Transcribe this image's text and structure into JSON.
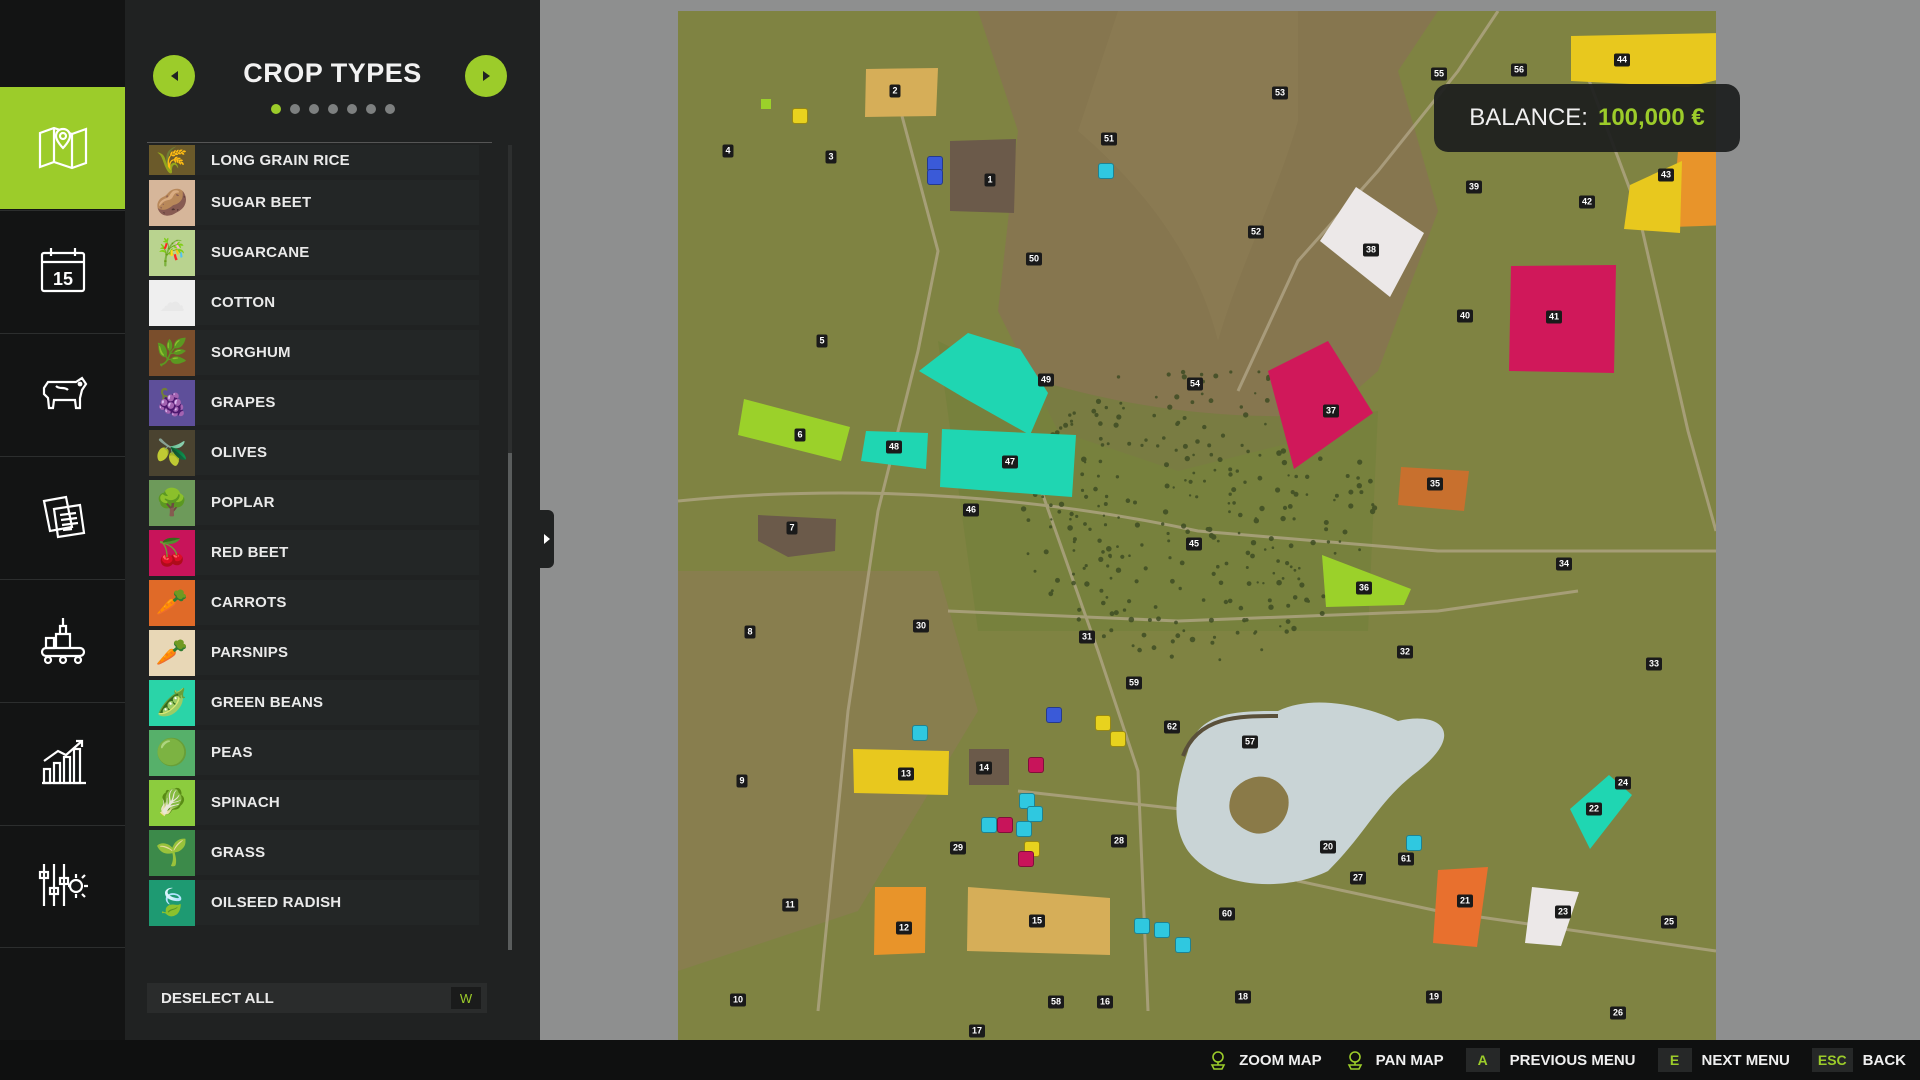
{
  "nav": {
    "items": [
      {
        "name": "map",
        "icon": "map-icon",
        "active": true
      },
      {
        "name": "calendar",
        "icon": "calendar-icon",
        "day": "15"
      },
      {
        "name": "animals",
        "icon": "cow-icon"
      },
      {
        "name": "contracts",
        "icon": "documents-icon"
      },
      {
        "name": "production",
        "icon": "factory-icon"
      },
      {
        "name": "statistics",
        "icon": "chart-icon"
      },
      {
        "name": "settings",
        "icon": "settings-icon"
      }
    ]
  },
  "panel": {
    "title": "CROP TYPES",
    "pages": 7,
    "active_page": 1,
    "crops": [
      {
        "label": "LONG GRAIN RICE",
        "icon": "rice-icon",
        "glyph": "🌾",
        "color": "#6b5a2a"
      },
      {
        "label": "SUGAR BEET",
        "icon": "sugar-beet-icon",
        "glyph": "🥔",
        "color": "#d6b69a"
      },
      {
        "label": "SUGARCANE",
        "icon": "sugarcane-icon",
        "glyph": "🎋",
        "color": "#b9d38f"
      },
      {
        "label": "COTTON",
        "icon": "cotton-icon",
        "glyph": "☁",
        "color": "#efefef"
      },
      {
        "label": "SORGHUM",
        "icon": "sorghum-icon",
        "glyph": "🌿",
        "color": "#7a4e2c"
      },
      {
        "label": "GRAPES",
        "icon": "grapes-icon",
        "glyph": "🍇",
        "color": "#5e4f9a"
      },
      {
        "label": "OLIVES",
        "icon": "olives-icon",
        "glyph": "🫒",
        "color": "#4a4330"
      },
      {
        "label": "POPLAR",
        "icon": "poplar-icon",
        "glyph": "🌳",
        "color": "#6d9a5a"
      },
      {
        "label": "RED BEET",
        "icon": "red-beet-icon",
        "glyph": "🍒",
        "color": "#c8145a"
      },
      {
        "label": "CARROTS",
        "icon": "carrots-icon",
        "glyph": "🥕",
        "color": "#e06a28"
      },
      {
        "label": "PARSNIPS",
        "icon": "parsnips-icon",
        "glyph": "🥕",
        "color": "#e8d7b6"
      },
      {
        "label": "GREEN BEANS",
        "icon": "green-beans-icon",
        "glyph": "🫛",
        "color": "#2ad4a8"
      },
      {
        "label": "PEAS",
        "icon": "peas-icon",
        "glyph": "🟢",
        "color": "#56b06a"
      },
      {
        "label": "SPINACH",
        "icon": "spinach-icon",
        "glyph": "🥬",
        "color": "#8ccc3e"
      },
      {
        "label": "GRASS",
        "icon": "grass-icon",
        "glyph": "🌱",
        "color": "#3c8a4a"
      },
      {
        "label": "OILSEED RADISH",
        "icon": "oilseed-radish-icon",
        "glyph": "🍃",
        "color": "#1e9a72"
      }
    ],
    "deselect_label": "DESELECT ALL",
    "deselect_key": "W"
  },
  "balance": {
    "label": "BALANCE:",
    "value": "100,000 €"
  },
  "map": {
    "field_numbers": [
      "1",
      "2",
      "3",
      "4",
      "5",
      "6",
      "7",
      "8",
      "9",
      "10",
      "11",
      "12",
      "13",
      "14",
      "15",
      "16",
      "17",
      "18",
      "19",
      "20",
      "21",
      "22",
      "23",
      "24",
      "25",
      "26",
      "27",
      "28",
      "29",
      "30",
      "31",
      "32",
      "33",
      "34",
      "35",
      "36",
      "37",
      "38",
      "39",
      "40",
      "41",
      "42",
      "43",
      "44",
      "45",
      "46",
      "47",
      "48",
      "49",
      "50",
      "51",
      "52",
      "53",
      "54",
      "55",
      "56",
      "57",
      "58",
      "59",
      "60",
      "61",
      "62"
    ]
  },
  "hints": [
    {
      "icon": "joystick-icon",
      "label": "ZOOM MAP"
    },
    {
      "icon": "joystick-icon",
      "label": "PAN MAP"
    },
    {
      "key": "A",
      "label": "PREVIOUS MENU"
    },
    {
      "key": "E",
      "label": "NEXT MENU"
    },
    {
      "key": "ESC",
      "label": "BACK"
    }
  ],
  "colors": {
    "accent": "#9ccc2a",
    "panel": "#202222",
    "nav": "#131414",
    "field_yellow": "#e8c81e",
    "field_teal": "#1fd6b2",
    "field_magenta": "#d0185a",
    "field_orange": "#e8942a",
    "field_lime": "#9bd12a",
    "field_white": "#ece8e8",
    "field_brown": "#6b5a4a",
    "field_tan": "#d6ae58",
    "field_copper": "#c8702e"
  }
}
